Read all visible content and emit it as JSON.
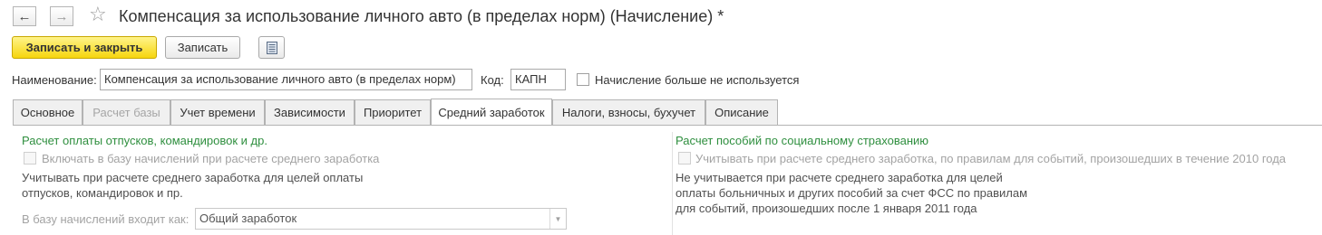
{
  "nav": {
    "back_icon": "←",
    "forward_icon": "→",
    "star_icon": "☆"
  },
  "title": "Компенсация за использование личного авто (в пределах норм) (Начисление) *",
  "toolbar": {
    "save_close_label": "Записать и закрыть",
    "save_label": "Записать",
    "report_icon": "report-icon"
  },
  "fields": {
    "name_label": "Наименование:",
    "name_value": "Компенсация за использование личного авто (в пределах норм)",
    "code_label": "Код:",
    "code_value": "КАПН",
    "unused_label": "Начисление больше не используется",
    "unused_checked": false
  },
  "tabs": [
    {
      "label": "Основное",
      "state": "normal"
    },
    {
      "label": "Расчет базы",
      "state": "disabled"
    },
    {
      "label": "Учет времени",
      "state": "normal"
    },
    {
      "label": "Зависимости",
      "state": "normal"
    },
    {
      "label": "Приоритет",
      "state": "normal"
    },
    {
      "label": "Средний заработок",
      "state": "active"
    },
    {
      "label": "Налоги, взносы, бухучет",
      "state": "normal"
    },
    {
      "label": "Описание",
      "state": "normal"
    }
  ],
  "left": {
    "heading": "Расчет оплаты отпусков, командировок и др.",
    "checkbox_label": "Включать в базу начислений при расчете среднего заработка",
    "note_line1": "Учитывать при расчете среднего заработка для целей оплаты",
    "note_line2": "отпусков, командировок и пр.",
    "base_label": "В базу начислений входит как:",
    "base_value": "Общий заработок"
  },
  "right": {
    "heading": "Расчет пособий по социальному страхованию",
    "checkbox_label": "Учитывать при расчете среднего заработка, по правилам для событий, произошедших в течение 2010 года",
    "note_line1": "Не учитывается при расчете среднего заработка для целей",
    "note_line2": "оплаты больничных и других пособий за счет ФСС по правилам",
    "note_line3": "для событий, произошедших после 1 января 2011 года"
  }
}
